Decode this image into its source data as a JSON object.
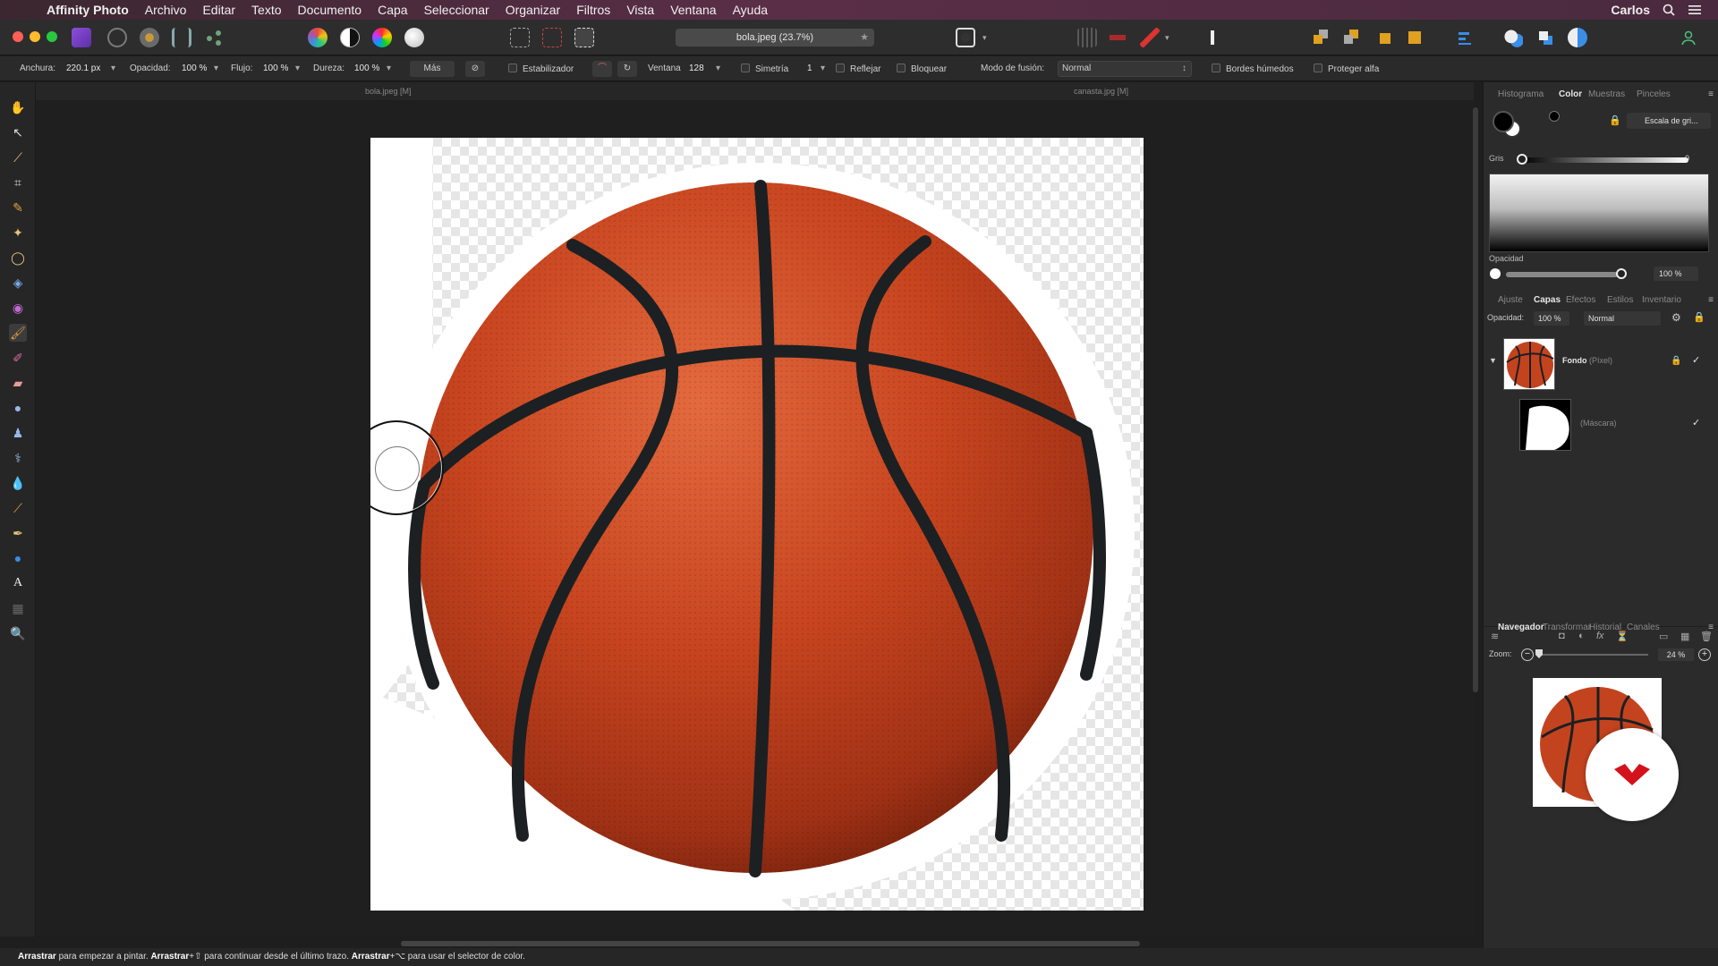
{
  "menubar": {
    "app_name": "Affinity Photo",
    "items": [
      "Archivo",
      "Editar",
      "Texto",
      "Documento",
      "Capa",
      "Seleccionar",
      "Organizar",
      "Filtros",
      "Vista",
      "Ventana",
      "Ayuda"
    ],
    "user": "Carlos"
  },
  "toolbar": {
    "document_tab": "bola.jpeg (23.7%)"
  },
  "context_toolbar": {
    "width_label": "Anchura:",
    "width_value": "220.1 px",
    "opacity_label": "Opacidad:",
    "opacity_value": "100 %",
    "flow_label": "Flujo:",
    "flow_value": "100 %",
    "hardness_label": "Dureza:",
    "hardness_value": "100 %",
    "more_button": "Más",
    "stabilizer_label": "Estabilizador",
    "window_label": "Ventana",
    "window_value": "128",
    "symmetry_label": "Simetría",
    "symmetry_value": "1",
    "mirror_label": "Reflejar",
    "lock_label": "Bloquear",
    "blend_mode_label": "Modo de fusión:",
    "blend_mode_value": "Normal",
    "wet_edges_label": "Bordes húmedos",
    "protect_alpha_label": "Proteger alfa"
  },
  "document_tabs": [
    "bola.jpeg [M]",
    "canasta.jpg [M]"
  ],
  "statusbar": {
    "parts": [
      {
        "bold": "Arrastrar",
        "text": " para empezar a pintar. "
      },
      {
        "bold": "Arrastrar",
        "text": "+⇧ para continuar desde el último trazo. "
      },
      {
        "bold": "Arrastrar",
        "text": "+⌥ para usar el selector de color."
      }
    ]
  },
  "color_panel": {
    "tabs": [
      "Histograma",
      "Color",
      "Muestras",
      "Pinceles"
    ],
    "active_tab": "Color",
    "mode": "Escala de gri...",
    "gray_label": "Gris",
    "gray_value": "0",
    "opacity_label": "Opacidad",
    "opacity_value": "100 %"
  },
  "layers_panel": {
    "tabs": [
      "Ajuste",
      "Capas",
      "Efectos",
      "Estilos",
      "Inventario"
    ],
    "active_tab": "Capas",
    "opacity_label": "Opacidad:",
    "opacity_value": "100 %",
    "blend_value": "Normal",
    "layers": [
      {
        "name": "Fondo",
        "type": "(Píxel)",
        "visible": "✓"
      },
      {
        "name": "",
        "type": "(Máscara)",
        "visible": "✓"
      }
    ]
  },
  "navigator_panel": {
    "tabs": [
      "Navegador",
      "Transformar",
      "Historial",
      "Canales"
    ],
    "active_tab": "Navegador",
    "zoom_label": "Zoom:",
    "zoom_value": "24 %"
  },
  "colors": {
    "ball": "#c4431f",
    "seams": "#1c2022",
    "accent_red": "#d3121b"
  }
}
